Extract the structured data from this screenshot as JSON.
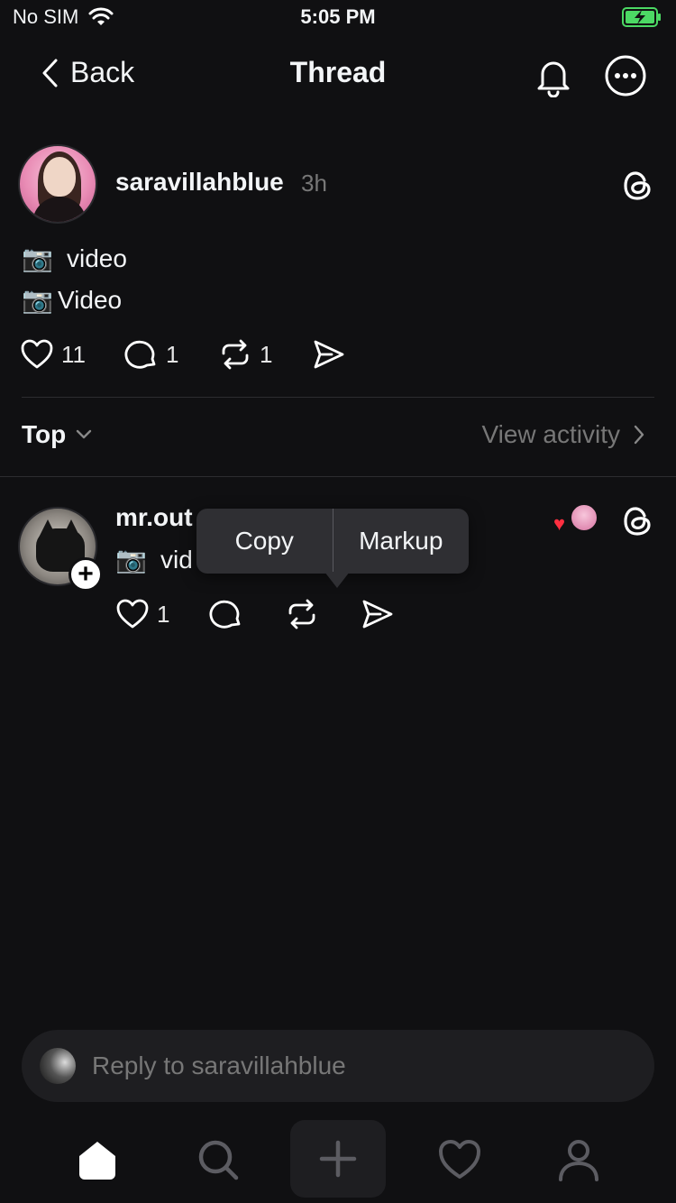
{
  "status_bar": {
    "carrier": "No SIM",
    "time": "5:05 PM"
  },
  "nav": {
    "back_label": "Back",
    "title": "Thread"
  },
  "post": {
    "username": "saravillahblue",
    "time": "3h",
    "lines": [
      {
        "emoji": "📷",
        "text": "video"
      },
      {
        "emoji": "📷",
        "text": "Video"
      }
    ],
    "likes": "11",
    "comments": "1",
    "reposts": "1"
  },
  "sort": {
    "label": "Top",
    "view_activity": "View activity"
  },
  "reply": {
    "username": "mr.out",
    "emoji": "📷",
    "text": "vid",
    "likes": "1"
  },
  "edit_menu": {
    "copy": "Copy",
    "markup": "Markup"
  },
  "composer": {
    "placeholder": "Reply to saravillahblue"
  },
  "colors": {
    "background": "#101012",
    "text": "#f3f5f7",
    "muted": "#777777",
    "like_red": "#ff2f40",
    "battery_green": "#4cd964"
  },
  "icons": [
    "wifi-icon",
    "battery-icon",
    "chevron-left-icon",
    "bell-icon",
    "more-icon",
    "threads-logo-icon",
    "heart-icon",
    "comment-icon",
    "repost-icon",
    "share-icon",
    "chevron-down-icon",
    "chevron-right-icon",
    "plus-icon",
    "home-icon",
    "search-icon",
    "person-icon"
  ]
}
